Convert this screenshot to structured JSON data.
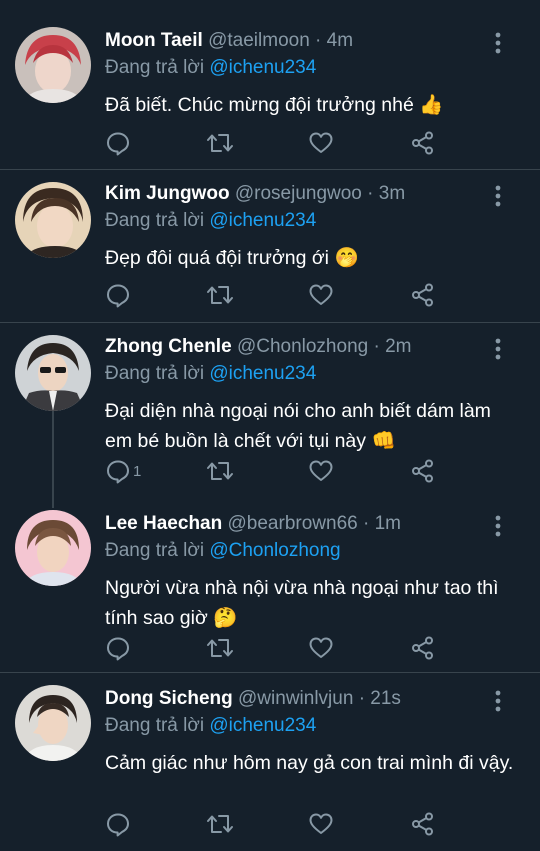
{
  "reply_prefix": "Đang trả lời",
  "dot": "·",
  "colors": {
    "background": "#15202b",
    "muted": "#8899a6",
    "link": "#1da1f2",
    "divider": "#38444d"
  },
  "tweets": [
    {
      "name": "Moon Taeil",
      "handle": "@taeilmoon",
      "time": "4m",
      "reply_to": "@ichenu234",
      "text": "Đã biết. Chúc mừng đội trưởng nhé",
      "emoji": "👍",
      "reply_count": ""
    },
    {
      "name": "Kim Jungwoo",
      "handle": "@rosejungwoo",
      "time": "3m",
      "reply_to": "@ichenu234",
      "text": "Đẹp đôi quá đội trưởng ới",
      "emoji": "🤭",
      "reply_count": ""
    },
    {
      "name": "Zhong Chenle",
      "handle": "@Chonlozhong",
      "time": "2m",
      "reply_to": "@ichenu234",
      "text": "Đại diện nhà ngoại nói cho anh biết dám làm em bé buồn là chết với tụi này",
      "emoji": "👊",
      "reply_count": "1"
    },
    {
      "name": "Lee Haechan",
      "handle": "@bearbrown66",
      "time": "1m",
      "reply_to": "@Chonlozhong",
      "text": "Người vừa nhà nội vừa nhà ngoại như tao thì tính sao giờ",
      "emoji": "🤔",
      "reply_count": ""
    },
    {
      "name": "Dong Sicheng",
      "handle": "@winwinlvjun",
      "time": "21s",
      "reply_to": "@ichenu234",
      "text": "Cảm giác như hôm nay gả con trai mình đi vậy.",
      "emoji": "",
      "reply_count": ""
    }
  ],
  "icons": {
    "reply": "reply-icon",
    "retweet": "retweet-icon",
    "like": "heart-icon",
    "share": "share-icon",
    "more": "more-vertical-icon"
  }
}
